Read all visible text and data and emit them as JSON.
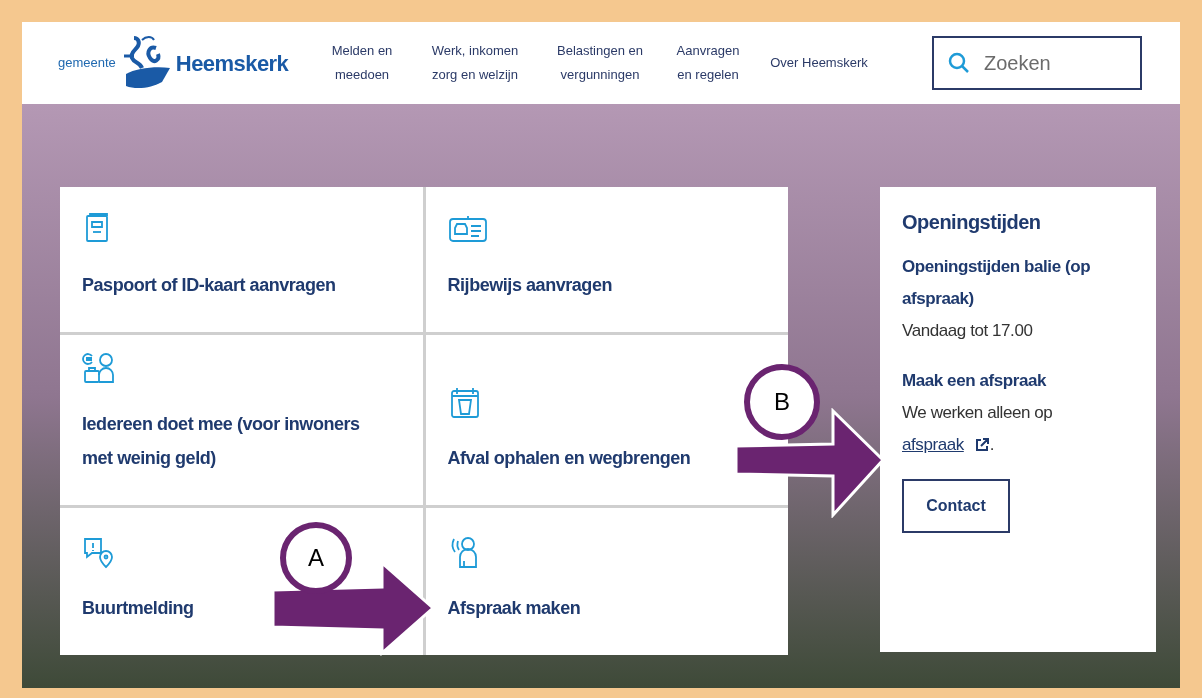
{
  "header": {
    "logo": {
      "prefix": "gemeente",
      "name": "Heemskerk"
    },
    "nav": [
      {
        "label": "Melden en meedoen"
      },
      {
        "label": "Werk, inkomen zorg en welzijn"
      },
      {
        "label": "Belastingen en vergunningen"
      },
      {
        "label": "Aanvragen en regelen"
      },
      {
        "label": "Over Heemskerk"
      }
    ],
    "search": {
      "placeholder": "Zoeken"
    }
  },
  "tiles": [
    {
      "kind": "passport",
      "title": "Paspoort of ID-kaart aanvragen"
    },
    {
      "kind": "license",
      "title": "Rijbewijs aanvragen"
    },
    {
      "kind": "money",
      "title": "Iedereen doet mee (voor inwoners met weinig geld)"
    },
    {
      "kind": "waste",
      "title": "Afval ophalen en wegbrengen"
    },
    {
      "kind": "report",
      "title": "Buurtmelding"
    },
    {
      "kind": "appointment",
      "title": "Afspraak maken"
    }
  ],
  "opening_hours": {
    "title": "Openingstijden",
    "sections": [
      {
        "heading": "Openingstijden balie (op afspraak)",
        "text": "Vandaag tot 17.00"
      },
      {
        "heading": "Maak een afspraak",
        "text": "We werken alleen op",
        "link": "afspraak",
        "suffix": "."
      }
    ],
    "button": "Contact"
  },
  "annotations": [
    {
      "label": "A"
    },
    {
      "label": "B"
    }
  ]
}
